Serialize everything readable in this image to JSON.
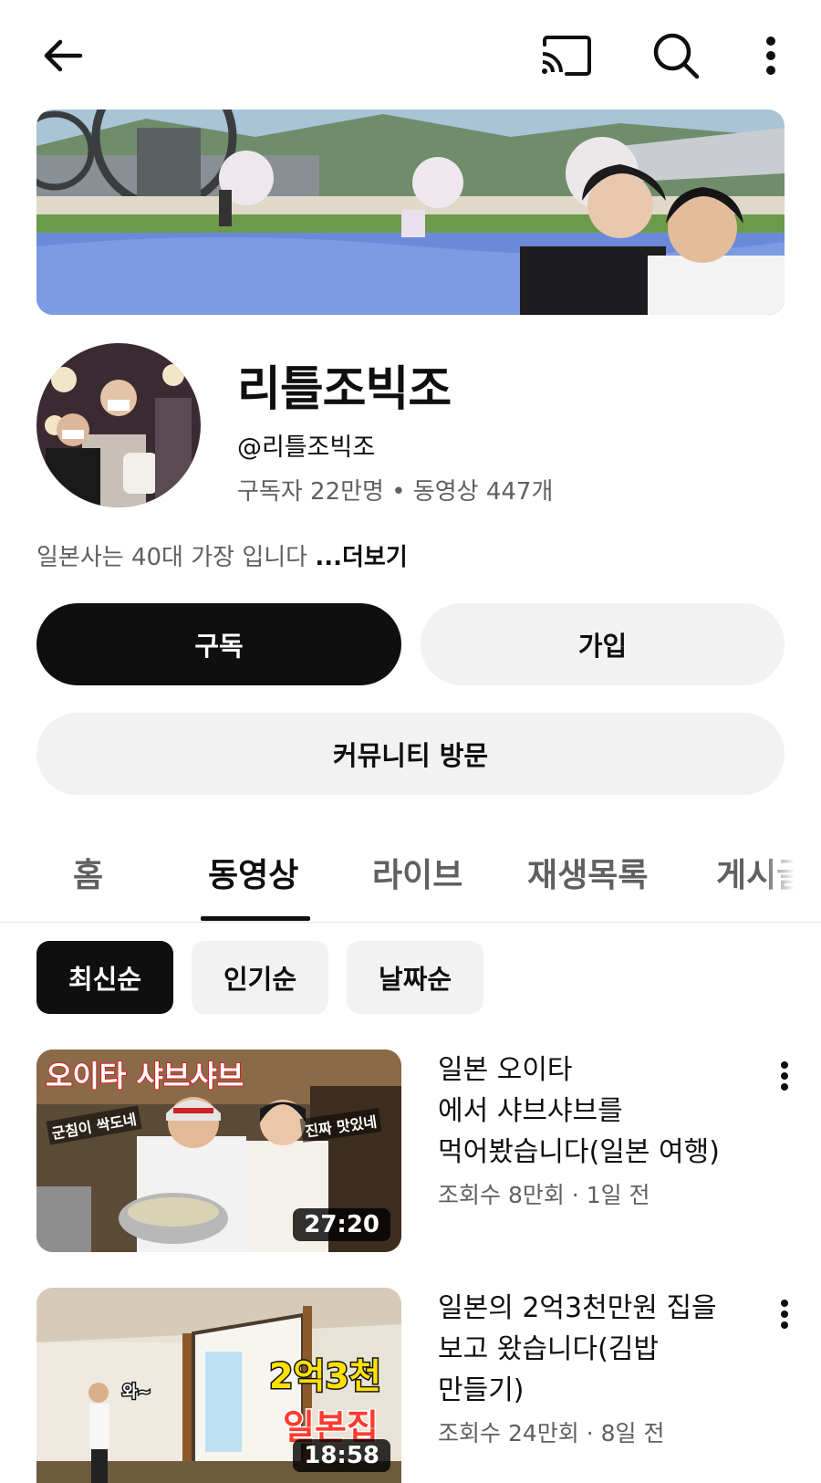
{
  "topbar": {
    "back_icon": "arrow-left-icon",
    "cast_icon": "cast-icon",
    "search_icon": "search-icon",
    "more_icon": "more-vert-icon"
  },
  "channel": {
    "name": "리틀조빅조",
    "handle": "@리틀조빅조",
    "subscribers": "구독자 22만명",
    "separator": "•",
    "videos": "동영상 447개",
    "description": "일본사는 40대 가장 입니다 ",
    "more_label": "...더보기"
  },
  "buttons": {
    "subscribe": "구독",
    "join": "가입",
    "community": "커뮤니티 방문"
  },
  "tabs": [
    {
      "label": "홈",
      "active": false
    },
    {
      "label": "동영상",
      "active": true
    },
    {
      "label": "라이브",
      "active": false
    },
    {
      "label": "재생목록",
      "active": false
    },
    {
      "label": "게시글",
      "active": false
    }
  ],
  "chips": [
    {
      "label": "최신순",
      "active": true
    },
    {
      "label": "인기순",
      "active": false
    },
    {
      "label": "날짜순",
      "active": false
    }
  ],
  "videos": [
    {
      "title_lines": [
        "일본 오이타",
        "에서 샤브샤브를",
        "먹어봤습니다(일본 여행)"
      ],
      "meta": "조회수 8만회 · 1일 전",
      "duration": "27:20",
      "thumb_texts": [
        "오이타 샤브샤브",
        "군침이 싹도네",
        "진짜 맛있네"
      ]
    },
    {
      "title_lines": [
        "일본의 2억3천만원 집을",
        "보고 왔습니다(김밥",
        "만들기)"
      ],
      "meta": "조회수 24만회 · 8일 전",
      "duration": "18:58",
      "thumb_texts": [
        "2억3천",
        "일본집",
        "와~"
      ]
    }
  ],
  "colors": {
    "text_primary": "#0f0f0f",
    "text_secondary": "#606060",
    "button_light": "#f2f2f2",
    "button_dark": "#0f0f0f"
  }
}
